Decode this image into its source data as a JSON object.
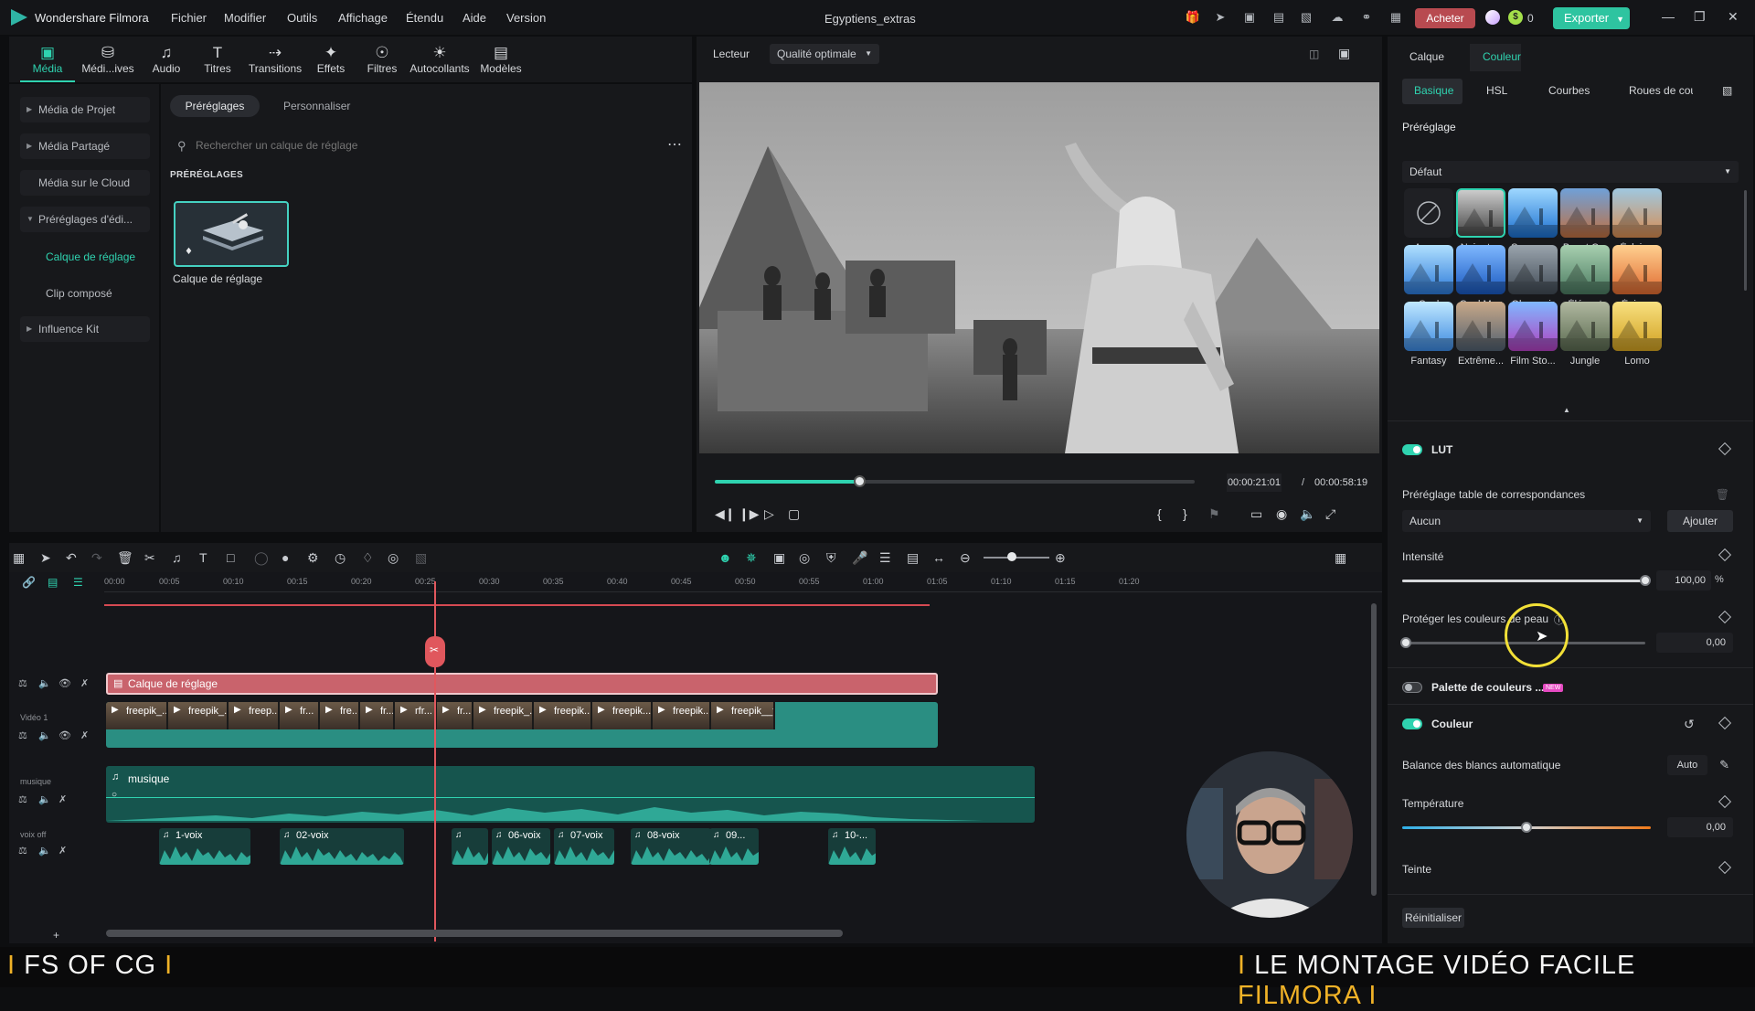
{
  "app": {
    "name": "Wondershare Filmora",
    "project_title": "Egyptiens_extras"
  },
  "menu": [
    "Fichier",
    "Modifier",
    "Outils",
    "Affichage",
    "Étendu",
    "Aide",
    "Version"
  ],
  "titlebar": {
    "buy_label": "Acheter",
    "coin_value": "0",
    "export_label": "Exporter"
  },
  "tooltabs": [
    {
      "label": "Média",
      "icon": "media-icon"
    },
    {
      "label": "Médi...ives",
      "icon": "stock-media-icon"
    },
    {
      "label": "Audio",
      "icon": "music-note-icon"
    },
    {
      "label": "Titres",
      "icon": "text-icon"
    },
    {
      "label": "Transitions",
      "icon": "transition-icon"
    },
    {
      "label": "Effets",
      "icon": "effects-icon"
    },
    {
      "label": "Filtres",
      "icon": "filter-icon"
    },
    {
      "label": "Autocollants",
      "icon": "sticker-icon"
    },
    {
      "label": "Modèles",
      "icon": "template-icon"
    }
  ],
  "leftnav": {
    "items": [
      "Média de Projet",
      "Média Partagé",
      "Média sur le Cloud",
      "Préréglages d'édi..."
    ],
    "sub": [
      "Calque de réglage",
      "Clip composé"
    ],
    "kit": "Influence Kit"
  },
  "assets": {
    "chip_active": "Préréglages",
    "chip_other": "Personnaliser",
    "search_placeholder": "Rechercher un calque de réglage",
    "section": "PRÉRÉGLAGES",
    "card_label": "Calque de réglage"
  },
  "player": {
    "label": "Lecteur",
    "quality": "Qualité optimale",
    "progress_percent": 30,
    "time_current": "00:00:21:01",
    "time_sep": "/",
    "time_total": "00:00:58:19"
  },
  "timeline": {
    "ruler": [
      "00:00",
      "00:05",
      "00:10",
      "00:15",
      "00:20",
      "00:25",
      "00:30",
      "00:35",
      "00:40",
      "00:45",
      "00:50",
      "00:55",
      "01:00",
      "01:05",
      "01:10",
      "01:15",
      "01:20"
    ],
    "tracks": {
      "video": "Vidéo 1",
      "music": "musique",
      "vox": "voix off"
    },
    "adjustment_clip": "Calque de réglage",
    "video_clips": [
      "freepik_...",
      "freepik_...",
      "freep...",
      "fr...",
      "fre...",
      "fr...",
      "rfr...",
      "fr...",
      "freepik_...",
      "freepik...",
      "freepik...",
      "freepik...",
      "freepik__ti..."
    ],
    "music_clip": "musique",
    "vox_clips": [
      "1-voix",
      "02-voix",
      "",
      "06-voix",
      "07-voix",
      "08-voix",
      "09...",
      "10-..."
    ]
  },
  "inspector": {
    "tabs": [
      "Calque",
      "Couleur"
    ],
    "subtabs": [
      "Basique",
      "HSL",
      "Courbes",
      "Roues de cou"
    ],
    "preset_title": "Préréglage",
    "preset_value": "Défaut",
    "presets": [
      "Aucun",
      "Noir et ...",
      "Superpr...",
      "Boost C...",
      "Éclairer",
      "Cool",
      "Cool Max",
      "Obscurcir",
      "Élégant",
      "Épique",
      "Fantasy",
      "Extrême...",
      "Film Sto...",
      "Jungle",
      "Lomo"
    ],
    "lut_label": "LUT",
    "lut_table_label": "Préréglage table de correspondances",
    "lut_value": "Aucun",
    "add_label": "Ajouter",
    "intensity_label": "Intensité",
    "intensity_value": "100,00",
    "intensity_unit": "%",
    "skin_label": "Protéger les couleurs de peau",
    "skin_value": "0,00",
    "palette_label": "Palette de couleurs ...",
    "palette_badge": "NEW",
    "color_label": "Couleur",
    "wb_label": "Balance des blancs automatique",
    "auto_label": "Auto",
    "temp_label": "Température",
    "temp_value": "0,00",
    "tint_label": "Teinte",
    "reset_label": "Réinitialiser"
  },
  "banner": {
    "left_bar": "I",
    "left_text": "FS OF CG",
    "left_bar2": "I",
    "right_bar": "I",
    "right_text": "LE MONTAGE VIDÉO FACILE",
    "right_hl": "FILMORA",
    "right_bar2": "I"
  },
  "colors": {
    "accent": "#2fd3b0",
    "adjust": "#c9636c",
    "buy": "#b84a50",
    "banner_accent": "#f0b227"
  }
}
